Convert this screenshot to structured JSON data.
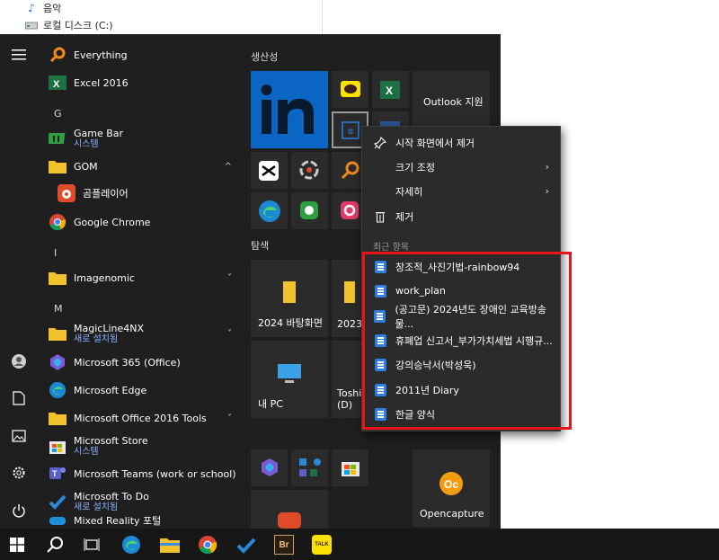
{
  "explorer": {
    "items": [
      {
        "label": "음악",
        "icon": "music-note-icon"
      },
      {
        "label": "로컬 디스크 (C:)",
        "icon": "drive-icon"
      }
    ]
  },
  "start_menu": {
    "rail": [
      "hamburger-icon",
      "user-icon",
      "document-icon",
      "pictures-icon",
      "settings-icon",
      "power-icon"
    ],
    "apps": [
      {
        "label": "Everything",
        "icon": "search-orange-icon"
      },
      {
        "label": "Excel 2016",
        "icon": "excel-icon"
      },
      {
        "letter": "G"
      },
      {
        "label": "Game Bar",
        "sub": "시스템",
        "icon": "gamebar-icon"
      },
      {
        "label": "GOM",
        "icon": "folder-icon",
        "expand": "^"
      },
      {
        "label": "곰플레이어",
        "icon": "gomplayer-icon"
      },
      {
        "label": "Google Chrome",
        "icon": "chrome-icon"
      },
      {
        "letter": "I"
      },
      {
        "label": "Imagenomic",
        "icon": "folder-icon",
        "expand": "˅"
      },
      {
        "letter": "M"
      },
      {
        "label": "MagicLine4NX",
        "sub": "새로 설치됨",
        "icon": "folder-icon",
        "expand": "˅"
      },
      {
        "label": "Microsoft 365 (Office)",
        "icon": "m365-icon"
      },
      {
        "label": "Microsoft Edge",
        "icon": "edge-icon"
      },
      {
        "label": "Microsoft Office 2016 Tools",
        "icon": "folder-icon",
        "expand": "˅"
      },
      {
        "label": "Microsoft Store",
        "sub": "시스템",
        "icon": "store-icon"
      },
      {
        "label": "Microsoft Teams (work or school)",
        "icon": "teams-icon"
      },
      {
        "label": "Microsoft To Do",
        "sub": "새로 설치됨",
        "icon": "todo-icon"
      },
      {
        "label": "Mixed Reality 포털",
        "icon": "mixed-reality-icon"
      }
    ],
    "groups": {
      "productivity": "생산성",
      "explore": "탐색"
    },
    "tiles": {
      "outlook": "Outlook 지원",
      "wallpaper": "2024 바탕화면",
      "t2023": "2023",
      "mypc": "내 PC",
      "toshiba": "Toshi (D)",
      "opencapture": "Opencapture"
    }
  },
  "context_menu": {
    "items": [
      {
        "label": "시작 화면에서 제거",
        "icon": "unpin-icon"
      },
      {
        "label": "크기 조정",
        "arrow": "›"
      },
      {
        "label": "자세히",
        "arrow": "›"
      },
      {
        "label": "제거",
        "icon": "trash-icon"
      }
    ],
    "recent_header": "최근 항목",
    "recent": [
      "창조적_사진기법-rainbow94",
      "work_plan",
      "(공고문) 2024년도 장애인 교육방송물...",
      "휴폐업 신고서_부가가치세법 시행규...",
      "강의승낙서(박성욱)",
      "2011년 Diary",
      "한글 양식"
    ]
  },
  "taskbar": {
    "icons": [
      "windows-start-icon",
      "search-icon",
      "task-view-icon",
      "edge-icon",
      "file-explorer-icon",
      "chrome-icon",
      "todo-icon",
      "bridge-icon",
      "kakaotalk-icon"
    ],
    "bridge_label": "Br",
    "kakao_label": "TALK"
  },
  "colors": {
    "highlight": "#e8141b",
    "accent": "#2f7fe0",
    "start_bg": "#1f1f1f"
  }
}
